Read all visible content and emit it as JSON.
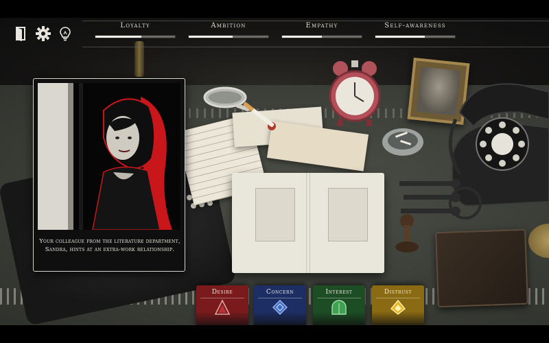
{
  "hud": {
    "icons": [
      "door-exit-icon",
      "gear-icon",
      "lightbulb-icon"
    ],
    "stats": [
      {
        "label": "Loyalty",
        "value": 0.58
      },
      {
        "label": "Ambition",
        "value": 0.55
      },
      {
        "label": "Empathy",
        "value": 0.5
      },
      {
        "label": "Self-awareness",
        "value": 0.62
      }
    ]
  },
  "story_card": {
    "text": "Your colleague from the literature department, Sandra, hints at an extra-work relationship."
  },
  "categories": [
    {
      "label": "Desire",
      "color": "#7a1a1c",
      "accent": "#b8323a"
    },
    {
      "label": "Concern",
      "color": "#1c2e63",
      "accent": "#3c68c4"
    },
    {
      "label": "Interest",
      "color": "#1d4d25",
      "accent": "#3fa052"
    },
    {
      "label": "Distrust",
      "color": "#8a6a12",
      "accent": "#e5b52a"
    }
  ],
  "colors": {
    "hud_text": "#e3e0d6",
    "card_border": "#d8d6cf",
    "portrait_red": "#c8161b"
  }
}
